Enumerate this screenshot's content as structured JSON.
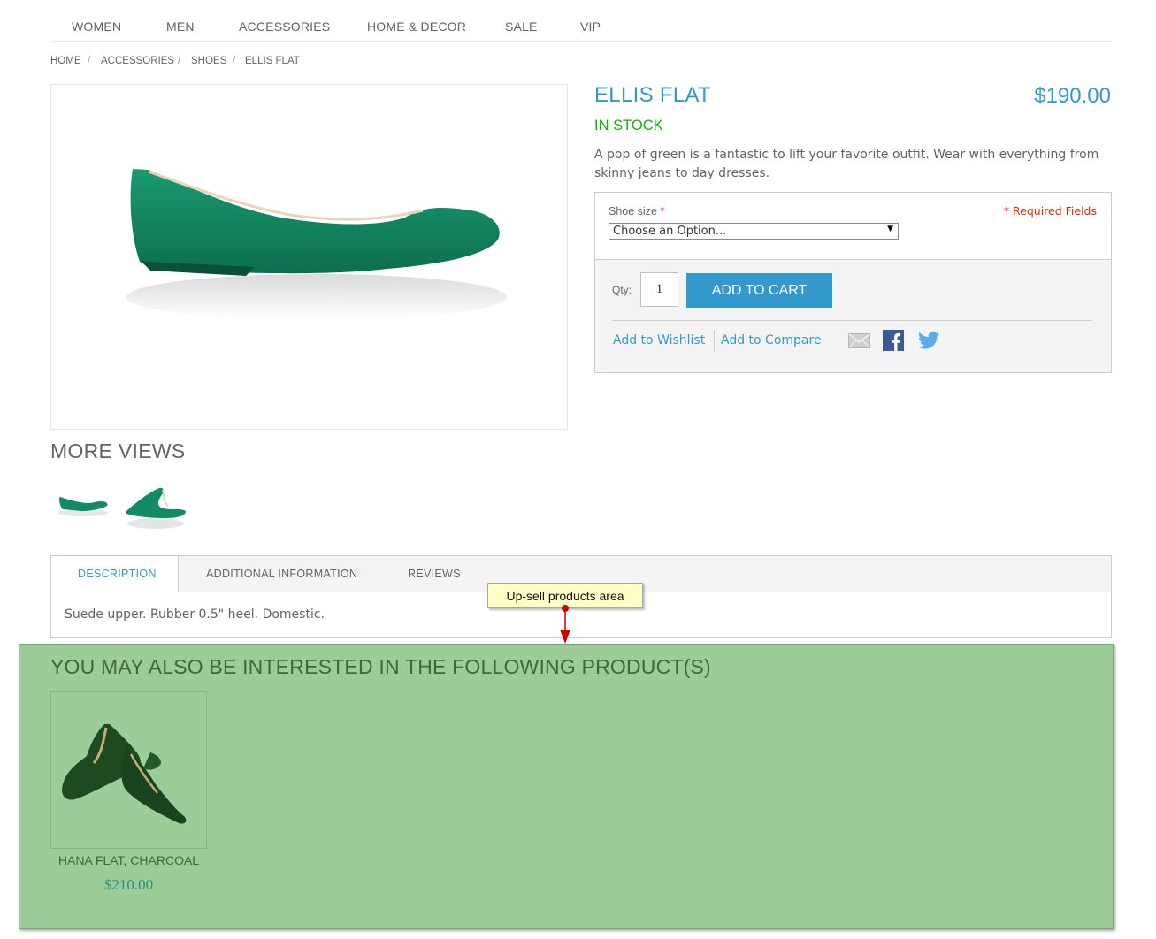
{
  "nav": {
    "items": [
      "WOMEN",
      "MEN",
      "ACCESSORIES",
      "HOME & DECOR",
      "SALE",
      "VIP"
    ]
  },
  "breadcrumb": {
    "items": [
      "HOME",
      "ACCESSORIES",
      "SHOES",
      "ELLIS FLAT"
    ],
    "separator": "/"
  },
  "product": {
    "name": "ELLIS FLAT",
    "price": "$190.00",
    "stock": "IN STOCK",
    "description": "A pop of green is a fantastic to lift your favorite outfit. Wear with everything from skinny jeans to day dresses.",
    "image_icon": "green-flat-shoe-image"
  },
  "options": {
    "label": "Shoe size",
    "required_star": "*",
    "required_note": "* Required Fields",
    "select_value": "Choose an Option..."
  },
  "cart": {
    "qty_label": "Qty:",
    "qty_value": "1",
    "add_label": "ADD TO CART",
    "wishlist_label": "Add to Wishlist",
    "compare_label": "Add to Compare",
    "share_icons": [
      "email-icon",
      "facebook-icon",
      "twitter-icon"
    ]
  },
  "more_views": {
    "title": "MORE VIEWS"
  },
  "tabs": {
    "items": [
      "DESCRIPTION",
      "ADDITIONAL INFORMATION",
      "REVIEWS"
    ],
    "active": "DESCRIPTION",
    "content": "Suede upper. Rubber 0.5\" heel. Domestic."
  },
  "callout": {
    "text": "Up-sell products area"
  },
  "upsell": {
    "title": "YOU MAY ALSO BE INTERESTED IN THE FOLLOWING PRODUCT(S)",
    "products": [
      {
        "name": "HANA FLAT, CHARCOAL",
        "price": "$210.00"
      }
    ]
  },
  "colors": {
    "accent": "#3399cc",
    "stock": "#11b400",
    "required": "#df280a",
    "upsell_bg": "#9ccc98",
    "callout_bg": "#ffffc6"
  }
}
